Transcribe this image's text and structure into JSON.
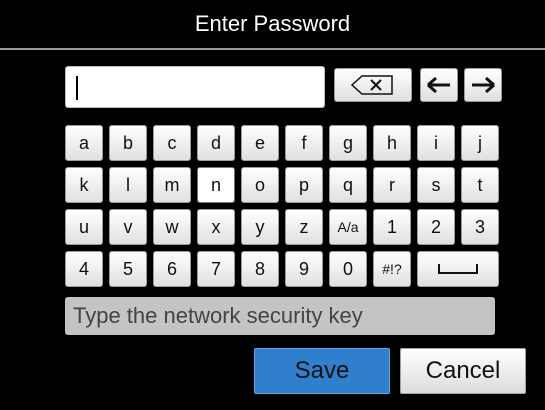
{
  "dialog": {
    "title": "Enter Password"
  },
  "password_field": {
    "value": ""
  },
  "controls": {
    "backspace_glyph": "⌫",
    "left_arrow_glyph": "←",
    "right_arrow_glyph": "→"
  },
  "keyboard": {
    "row1": [
      "a",
      "b",
      "c",
      "d",
      "e",
      "f",
      "g",
      "h",
      "i",
      "j"
    ],
    "row2": [
      "k",
      "l",
      "m",
      "n",
      "o",
      "p",
      "q",
      "r",
      "s",
      "t"
    ],
    "row3": [
      "u",
      "v",
      "w",
      "x",
      "y",
      "z",
      "A/a",
      "1",
      "2",
      "3"
    ],
    "row4": [
      "4",
      "5",
      "6",
      "7",
      "8",
      "9",
      "0",
      "#!?"
    ],
    "space_glyph": "⎵"
  },
  "hint": {
    "text": "Type the network security key"
  },
  "buttons": {
    "save": "Save",
    "cancel": "Cancel"
  }
}
